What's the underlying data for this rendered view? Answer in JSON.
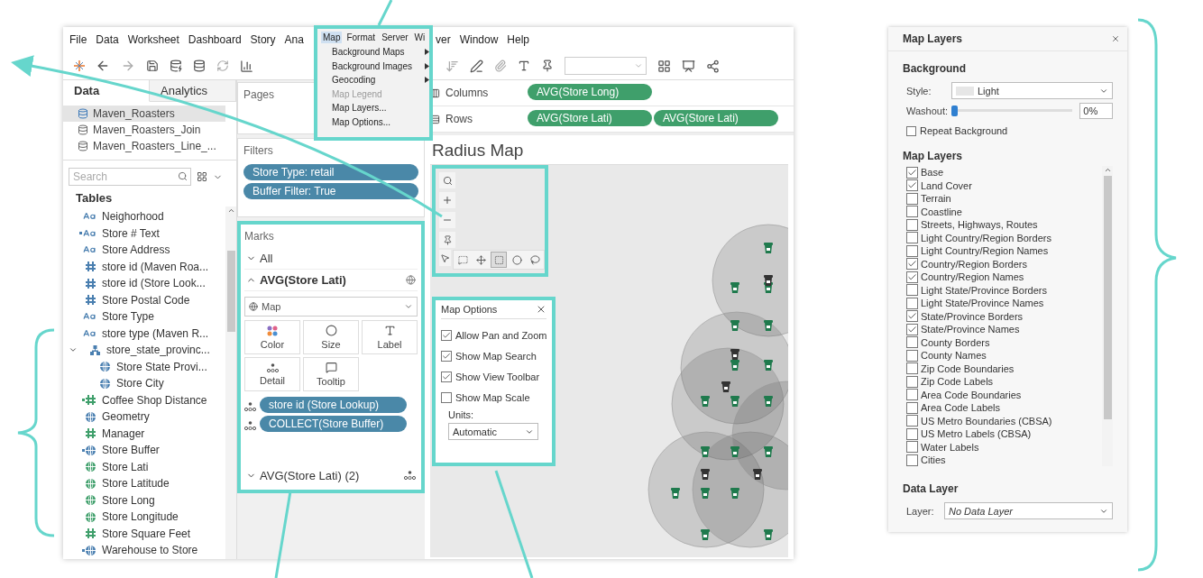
{
  "menubar": {
    "left": [
      "File",
      "Data",
      "Worksheet",
      "Dashboard",
      "Story",
      "Ana"
    ],
    "right": [
      "ver",
      "Window",
      "Help"
    ]
  },
  "map_menu": {
    "strip": [
      {
        "label": "Map",
        "selected": true
      },
      {
        "label": "Format",
        "selected": false
      },
      {
        "label": "Server",
        "selected": false
      },
      {
        "label": "Wi",
        "selected": false
      }
    ],
    "items": [
      {
        "label": "Background Maps",
        "submenu": true,
        "disabled": false
      },
      {
        "label": "Background Images",
        "submenu": true,
        "disabled": false
      },
      {
        "label": "Geocoding",
        "submenu": true,
        "disabled": false
      },
      {
        "label": "Map Legend",
        "submenu": false,
        "disabled": true
      },
      {
        "label": "Map Layers...",
        "submenu": false,
        "disabled": false
      },
      {
        "label": "Map Options...",
        "submenu": false,
        "disabled": false
      }
    ]
  },
  "data_pane": {
    "tabs": [
      {
        "label": "Data",
        "selected": true
      },
      {
        "label": "Analytics",
        "selected": false
      }
    ],
    "sources": [
      {
        "name": "Maven_Roasters",
        "selected": true
      },
      {
        "name": "Maven_Roasters_Join",
        "selected": false
      },
      {
        "name": "Maven_Roasters_Line_...",
        "selected": false
      }
    ],
    "search": {
      "placeholder": "Search"
    },
    "tables_heading": "Tables",
    "fields": [
      {
        "name": "Neighorhood",
        "kind": "text",
        "color": "#4a7fb0",
        "calculated": false
      },
      {
        "name": "Store # Text",
        "kind": "text",
        "color": "#4a7fb0",
        "calculated": true
      },
      {
        "name": "Store Address",
        "kind": "text",
        "color": "#4a7fb0",
        "calculated": false
      },
      {
        "name": "store id (Maven Roa...",
        "kind": "number",
        "color": "#4a7fb0",
        "calculated": false
      },
      {
        "name": "store id (Store Look...",
        "kind": "number",
        "color": "#4a7fb0",
        "calculated": false
      },
      {
        "name": "Store Postal Code",
        "kind": "number",
        "color": "#4a7fb0",
        "calculated": false
      },
      {
        "name": "Store Type",
        "kind": "text",
        "color": "#4a7fb0",
        "calculated": false
      },
      {
        "name": "store type (Maven R...",
        "kind": "text",
        "color": "#4a7fb0",
        "calculated": false
      },
      {
        "name": "store_state_provinc...",
        "kind": "hierarchy",
        "color": "#4a7fb0",
        "calculated": false,
        "expanded": true,
        "children": [
          {
            "name": "Store State Provi...",
            "kind": "geo",
            "color": "#4a7fb0",
            "calculated": false
          },
          {
            "name": "Store City",
            "kind": "geo",
            "color": "#4a7fb0",
            "calculated": false
          }
        ]
      },
      {
        "name": "Coffee Shop Distance",
        "kind": "number",
        "color": "#3f9f6b",
        "calculated": true
      },
      {
        "name": "Geometry",
        "kind": "geo",
        "color": "#4a7fb0",
        "calculated": false
      },
      {
        "name": "Manager",
        "kind": "number",
        "color": "#3f9f6b",
        "calculated": false
      },
      {
        "name": "Store Buffer",
        "kind": "geo",
        "color": "#4a7fb0",
        "calculated": true
      },
      {
        "name": "Store Lati",
        "kind": "geo",
        "color": "#3f9f6b",
        "calculated": false
      },
      {
        "name": "Store Latitude",
        "kind": "geo",
        "color": "#3f9f6b",
        "calculated": false
      },
      {
        "name": "Store Long",
        "kind": "geo",
        "color": "#3f9f6b",
        "calculated": false
      },
      {
        "name": "Store Longitude",
        "kind": "geo",
        "color": "#3f9f6b",
        "calculated": false
      },
      {
        "name": "Store Square Feet",
        "kind": "number",
        "color": "#3f9f6b",
        "calculated": false
      },
      {
        "name": "Warehouse to Store",
        "kind": "geo",
        "color": "#4a7fb0",
        "calculated": true
      }
    ]
  },
  "pages": {
    "title": "Pages"
  },
  "filters": {
    "title": "Filters",
    "pills": [
      "Store Type: retail",
      "Buffer Filter: True"
    ]
  },
  "marks": {
    "title": "Marks",
    "all": {
      "label": "All",
      "expanded": false
    },
    "layer": {
      "label": "AVG(Store Lati)",
      "expanded": true
    },
    "mark_type": "Map",
    "buttons": [
      {
        "label": "Color",
        "kind": "color"
      },
      {
        "label": "Size",
        "kind": "size"
      },
      {
        "label": "Label",
        "kind": "label"
      },
      {
        "label": "Detail",
        "kind": "detail"
      },
      {
        "label": "Tooltip",
        "kind": "tooltip"
      }
    ],
    "pills": [
      {
        "text": "store id (Store Lookup)",
        "kind": "detail"
      },
      {
        "text": "COLLECT(Store Buffer)",
        "kind": "detail"
      }
    ],
    "layer2": {
      "label": "AVG(Store Lati) (2)",
      "expanded": false
    }
  },
  "columns": {
    "label": "Columns",
    "pills": [
      "AVG(Store Long)"
    ]
  },
  "rows": {
    "label": "Rows",
    "pills": [
      "AVG(Store Lati)",
      "AVG(Store Lati)"
    ]
  },
  "viz": {
    "title": "Radius Map"
  },
  "map_options": {
    "title": "Map Options",
    "options": [
      {
        "label": "Allow Pan and Zoom",
        "checked": true
      },
      {
        "label": "Show Map Search",
        "checked": true
      },
      {
        "label": "Show View Toolbar",
        "checked": true
      },
      {
        "label": "Show Map Scale",
        "checked": false
      }
    ],
    "units_label": "Units:",
    "units": "Automatic"
  },
  "map_layers_panel": {
    "title": "Map Layers",
    "background_heading": "Background",
    "style_label": "Style:",
    "style": "Light",
    "washout_label": "Washout:",
    "washout": {
      "level": 0
    },
    "washout_value": "0%",
    "repeat": {
      "label": "Repeat Background",
      "checked": false
    },
    "layers_heading": "Map Layers",
    "layers": [
      {
        "label": "Base",
        "checked": true
      },
      {
        "label": "Land Cover",
        "checked": true
      },
      {
        "label": "Terrain",
        "checked": false
      },
      {
        "label": "Coastline",
        "checked": false
      },
      {
        "label": "Streets, Highways, Routes",
        "checked": false
      },
      {
        "label": "Light Country/Region Borders",
        "checked": false
      },
      {
        "label": "Light Country/Region Names",
        "checked": false
      },
      {
        "label": "Country/Region Borders",
        "checked": true
      },
      {
        "label": "Country/Region Names",
        "checked": true
      },
      {
        "label": "Light State/Province Borders",
        "checked": false
      },
      {
        "label": "Light State/Province Names",
        "checked": false
      },
      {
        "label": "State/Province Borders",
        "checked": true
      },
      {
        "label": "State/Province Names",
        "checked": true
      },
      {
        "label": "County Borders",
        "checked": false
      },
      {
        "label": "County Names",
        "checked": false
      },
      {
        "label": "Zip Code Boundaries",
        "checked": false
      },
      {
        "label": "Zip Code Labels",
        "checked": false
      },
      {
        "label": "Area Code Boundaries",
        "checked": false
      },
      {
        "label": "Area Code Labels",
        "checked": false
      },
      {
        "label": "US Metro Boundaries (CBSA)",
        "checked": false
      },
      {
        "label": "US Metro Labels (CBSA)",
        "checked": false
      },
      {
        "label": "Water Labels",
        "checked": false
      },
      {
        "label": "Cities",
        "checked": false
      }
    ],
    "data_layer_heading": "Data Layer",
    "layer_label": "Layer:",
    "layer_value": "No Data Layer"
  }
}
